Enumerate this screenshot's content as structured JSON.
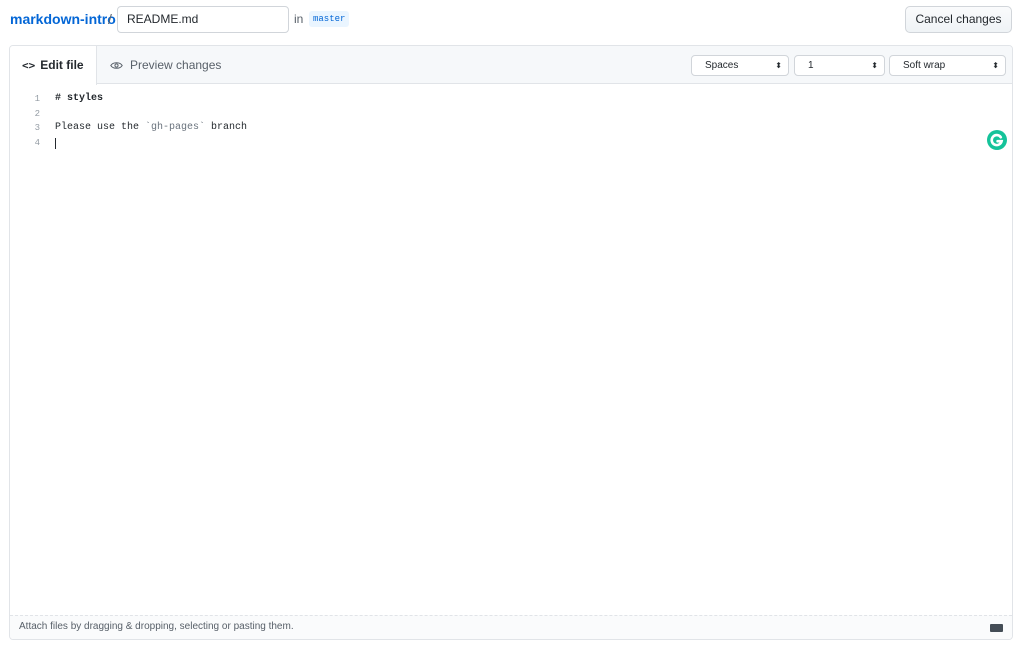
{
  "header": {
    "repo_name": "markdown-intro",
    "separator": "/",
    "filename": "README.md",
    "in_label": "in",
    "branch": "master",
    "cancel_label": "Cancel changes"
  },
  "tabs": {
    "edit_label": "Edit file",
    "preview_label": "Preview changes"
  },
  "options": {
    "indent_mode": "Spaces",
    "indent_size": "1",
    "wrap_mode": "Soft wrap"
  },
  "code_lines": [
    {
      "num": "1",
      "text": "# styles"
    },
    {
      "num": "2",
      "text": ""
    },
    {
      "num": "3",
      "text": "Please use the `gh-pages` branch"
    },
    {
      "num": "4",
      "text": ""
    }
  ],
  "footer": {
    "hint": "Attach files by dragging & dropping, selecting or pasting them."
  },
  "colors": {
    "link": "#0366d6",
    "grammarly": "#15c39a"
  }
}
